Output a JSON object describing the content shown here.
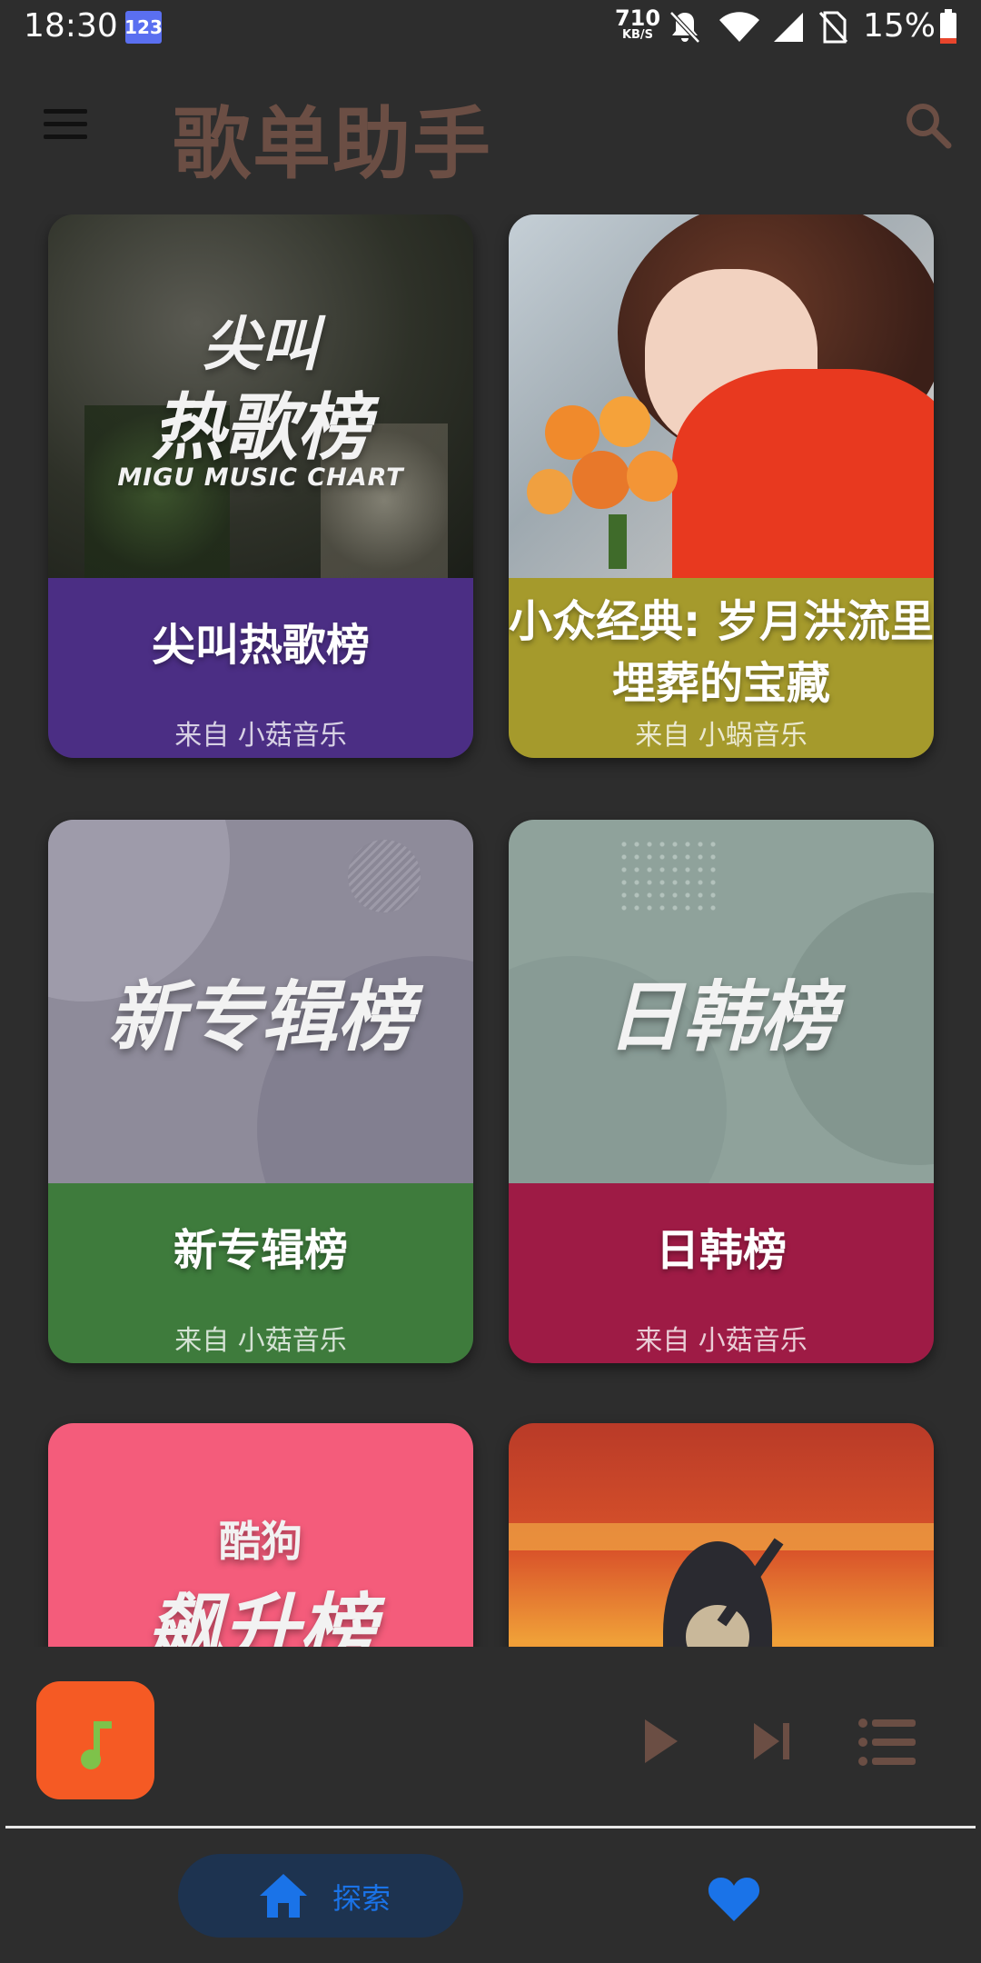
{
  "status_bar": {
    "time": "18:30",
    "badge": "123",
    "net_speed_value": "710",
    "net_speed_unit": "KB/S",
    "battery": "15%",
    "icons": [
      "mute-bell-icon",
      "wifi-icon",
      "signal-icon",
      "no-sim-icon",
      "battery-icon"
    ]
  },
  "app_bar": {
    "title": "歌单助手",
    "menu_icon": "menu-icon",
    "search_icon": "search-icon"
  },
  "cards": [
    {
      "title": "尖叫热歌榜",
      "source": "来自 小菇音乐",
      "color": "#4b2e84",
      "cover_text_line1": "尖叫",
      "cover_text_line2": "热歌榜",
      "cover_subtext": "MIGU MUSIC CHART"
    },
    {
      "title": "小众经典: 岁月洪流里埋葬的宝藏",
      "source": "来自 小蜗音乐",
      "color": "#a59a2c"
    },
    {
      "title": "新专辑榜",
      "source": "来自 小菇音乐",
      "color": "#3e7b3c",
      "cover_text": "新专辑榜"
    },
    {
      "title": "日韩榜",
      "source": "来自 小菇音乐",
      "color": "#9e1b45",
      "cover_text": "日韩榜"
    },
    {
      "cover_text_line1": "酷狗",
      "cover_text_line2": "飙升榜"
    },
    {}
  ],
  "player": {
    "thumb_icon": "music-note-icon",
    "play_icon": "play-icon",
    "next_icon": "skip-next-icon",
    "queue_icon": "queue-list-icon",
    "accent": "#f55a24"
  },
  "bottom_nav": {
    "explore_label": "探索",
    "explore_icon": "home-icon",
    "favorites_icon": "heart-icon",
    "active_color": "#1a73e8"
  }
}
